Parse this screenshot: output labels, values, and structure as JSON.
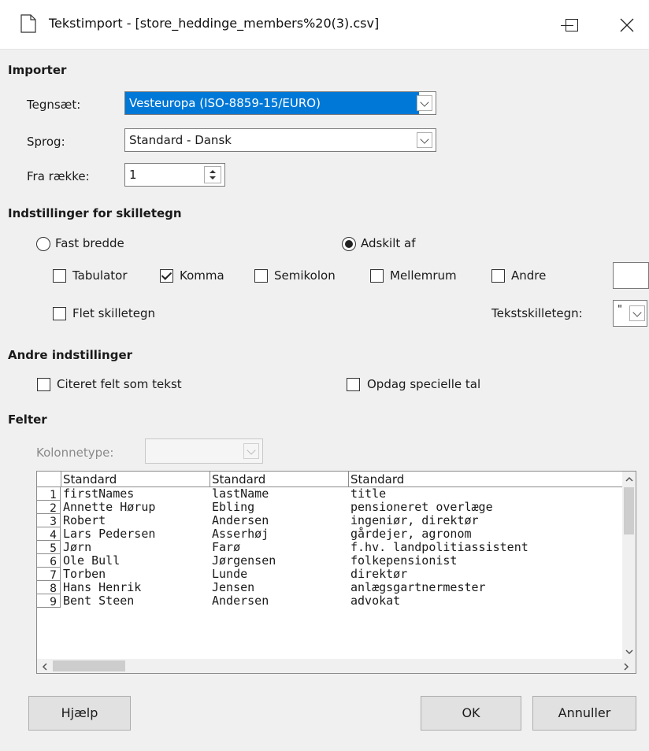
{
  "window": {
    "title": "Tekstimport - [store_heddinge_members%20(3).csv]"
  },
  "import": {
    "section_label": "Importer",
    "charset_label": "Tegnsæt:",
    "charset_value": "Vesteuropa (ISO-8859-15/EURO)",
    "language_label": "Sprog:",
    "language_value": "Standard - Dansk",
    "from_row_label": "Fra række:",
    "from_row_value": "1"
  },
  "separator": {
    "section_label": "Indstillinger for skilletegn",
    "fixed_width_label": "Fast bredde",
    "separated_by_label": "Adskilt af",
    "tab_label": "Tabulator",
    "comma_label": "Komma",
    "semicolon_label": "Semikolon",
    "space_label": "Mellemrum",
    "other_label": "Andre",
    "merge_label": "Flet skilletegn",
    "text_delim_label": "Tekstskilletegn:",
    "text_delim_value": "\"",
    "comma_checked": true
  },
  "other": {
    "section_label": "Andre indstillinger",
    "quoted_label": "Citeret felt som tekst",
    "detect_label": "Opdag specielle tal"
  },
  "fields": {
    "section_label": "Felter",
    "column_type_label": "Kolonnetype:",
    "headers": [
      "Standard",
      "Standard",
      "Standard"
    ],
    "rows": [
      {
        "n": "1",
        "c": [
          "firstNames",
          "lastName",
          "title"
        ]
      },
      {
        "n": "2",
        "c": [
          "Annette Hørup",
          "Ebling",
          "pensioneret overlæge"
        ]
      },
      {
        "n": "3",
        "c": [
          "Robert",
          "Andersen",
          "ingeniør, direktør"
        ]
      },
      {
        "n": "4",
        "c": [
          "Lars Pedersen",
          "Asserhøj",
          "gårdejer, agronom"
        ]
      },
      {
        "n": "5",
        "c": [
          "Jørn",
          "Farø",
          "f.hv. landpolitiassistent"
        ]
      },
      {
        "n": "6",
        "c": [
          "Ole Bull",
          "Jørgensen",
          "folkepensionist"
        ]
      },
      {
        "n": "7",
        "c": [
          "Torben",
          "Lunde",
          "direktør"
        ]
      },
      {
        "n": "8",
        "c": [
          "Hans Henrik",
          "Jensen",
          "anlægsgartnermester"
        ]
      },
      {
        "n": "9",
        "c": [
          "Bent Steen",
          "Andersen",
          "advokat"
        ]
      }
    ]
  },
  "buttons": {
    "help": "Hjælp",
    "ok": "OK",
    "cancel": "Annuller"
  },
  "colors": {
    "selection": "#0078d7",
    "background": "#f0f0f0"
  }
}
